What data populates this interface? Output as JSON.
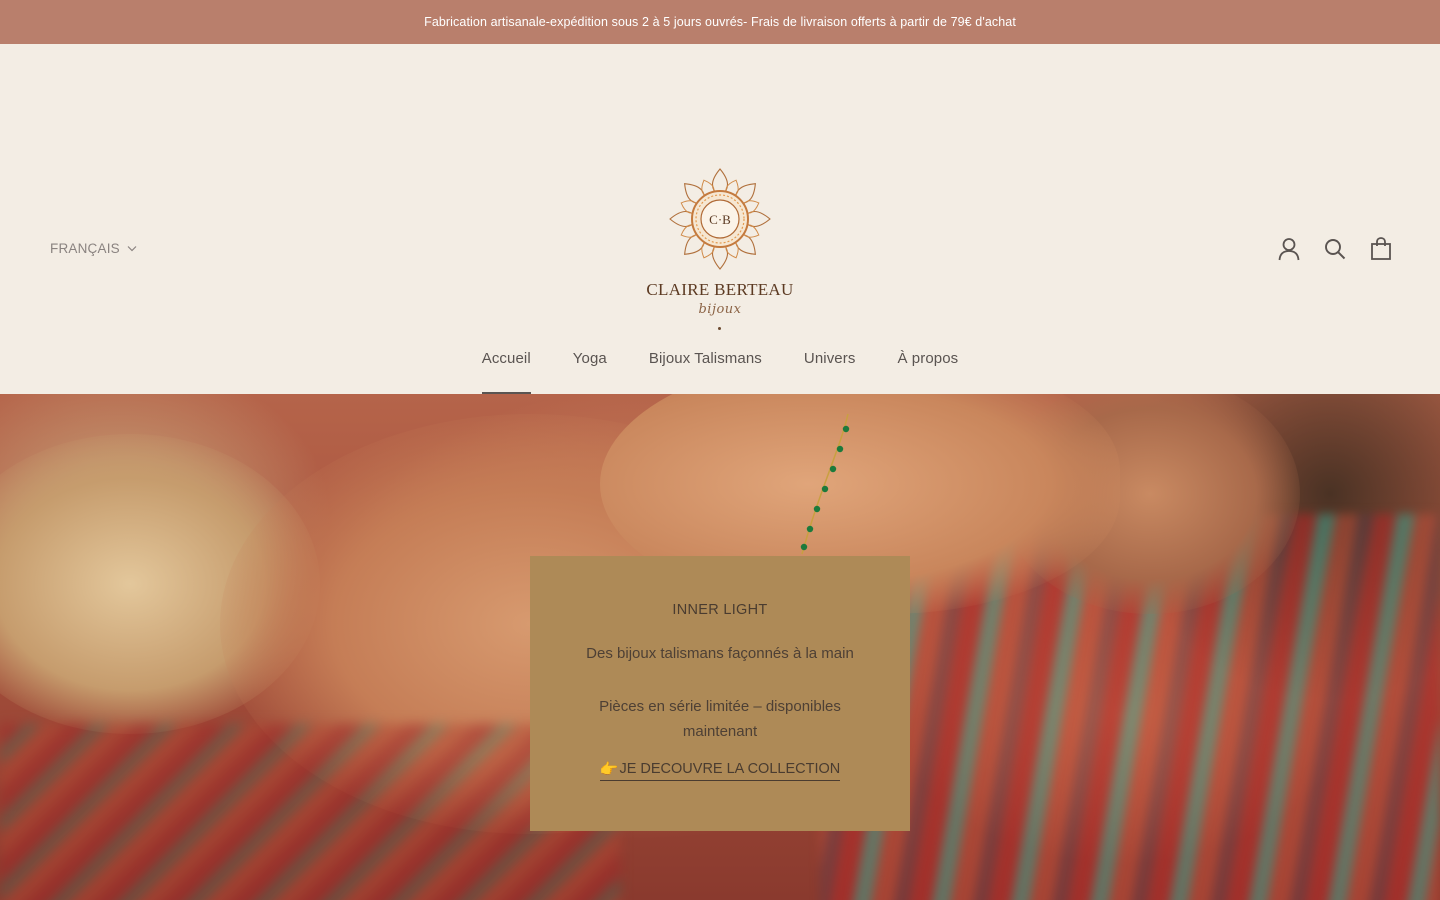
{
  "announcement": {
    "text": "Fabrication artisanale-expédition sous 2 à 5 jours ouvrés- Frais de livraison offerts à partir de 79€ d'achat"
  },
  "header": {
    "language": "FRANÇAIS",
    "logo": {
      "monogram": "C·B",
      "brand": "CLAIRE BERTEAU",
      "sub": "bijoux"
    },
    "icons": [
      "account-icon",
      "search-icon",
      "cart-icon"
    ]
  },
  "nav": {
    "items": [
      {
        "label": "Accueil",
        "active": true
      },
      {
        "label": "Yoga"
      },
      {
        "label": "Bijoux Talismans"
      },
      {
        "label": "Univers"
      },
      {
        "label": "À propos"
      }
    ]
  },
  "promo": {
    "title": "INNER LIGHT",
    "line1": "Des bijoux talismans façonnés à la main",
    "line2": "Pièces en série limitée – disponibles maintenant",
    "cta_emoji": "👉",
    "cta_label": "JE DECOUVRE LA COLLECTION"
  },
  "colors": {
    "announcement_bg": "#b97f6c",
    "page_bg": "#f3ede4",
    "promo_bg": "#ae8a57"
  }
}
